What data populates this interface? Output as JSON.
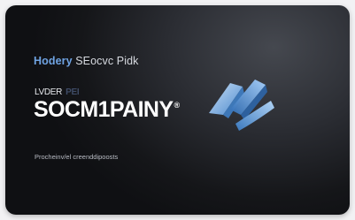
{
  "card": {
    "tagline_accent": "Hodery",
    "tagline_rest": "SEocvc Pidk",
    "eyebrow": "LVDER",
    "eyebrow_dim": "PEI",
    "company_name": "SOCM1PAINY",
    "company_mark": "®",
    "subtitle": "Procheinv/el creenddipoosts"
  },
  "logo": {
    "icon": "stylized-k-logo-icon",
    "colors": {
      "light": "#bfe0ff",
      "mid": "#6aa8e6",
      "dark": "#2f6db5"
    }
  }
}
